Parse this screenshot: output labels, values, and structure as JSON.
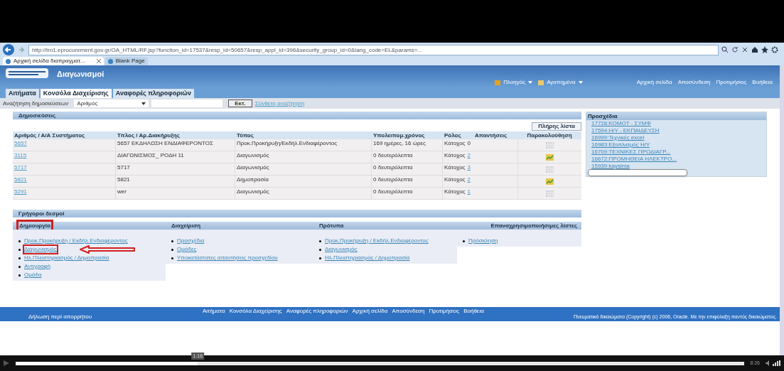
{
  "browser": {
    "address": "http://trn1.eprocurement.gov.gr/OA_HTML/RF.jsp?function_id=17537&resp_id=50657&resp_appl_id=396&security_group_id=0&lang_code=EL&params=...",
    "tabs": [
      {
        "label": "Αρχική σελίδα διαπραγματ...",
        "selected": true,
        "closable": true
      },
      {
        "label": "Blank Page",
        "selected": false,
        "closable": false
      }
    ]
  },
  "header": {
    "title": "Διαγωνισμοί",
    "menus": [
      "Πλοηγός",
      "Αγαπημένα"
    ],
    "links": [
      "Αρχική σελίδα",
      "Αποσύνδεση",
      "Προτιμήσεις",
      "Βοήθεια"
    ]
  },
  "tabs": [
    {
      "label": "Αιτήματα",
      "selected": false
    },
    {
      "label": "Κονσόλα Διαχείρισης",
      "selected": true
    },
    {
      "label": "Αναφορές πληροφοριών",
      "selected": false
    }
  ],
  "search": {
    "label": "Αναζήτηση δημοσιεύσεων",
    "select_value": "Αριθμός",
    "button": "Εκτ.",
    "advanced_link": "Σύνθετη αναζήτηση"
  },
  "publications": {
    "title": "Δημοσιεύσεις",
    "full_list_button": "Πλήρης λίστα",
    "columns": [
      "Αριθμός / Α/Α Συστήματος",
      "Τίτλος / Αρ.Διακήρυξης",
      "Τύπος",
      "Υπολειπομ.χρόνος",
      "Ρόλος",
      "Απαντήσεις",
      "Παρακολούθηση"
    ],
    "rows": [
      {
        "number": "5657",
        "title": "5657 ΕΚΔΗΛΩΣΗ ΕΝΔΙΑΦΕΡΟΝΤΟΣ",
        "type": "Προκ.Προκήρυξη/Εκδήλ.Ενδιαφέροντος",
        "time": "169 ημέρες, 16 ώρες",
        "role": "Κάτοχος",
        "responses": "0",
        "responses_link": false,
        "activity": false
      },
      {
        "number": "3115",
        "title": "ΔΙΑΓΩΝΙΣΜΟΣ_ ΡΟΔΗ 11",
        "type": "Διαγωνισμός",
        "time": "0 δευτερόλεπτα",
        "role": "Κάτοχος",
        "responses": "2",
        "responses_link": true,
        "activity": true
      },
      {
        "number": "5717",
        "title": "5717",
        "type": "Διαγωνισμός",
        "time": "0 δευτερόλεπτα",
        "role": "Κάτοχος",
        "responses": "3",
        "responses_link": true,
        "activity": false
      },
      {
        "number": "5821",
        "title": "5821",
        "type": "Δημοπρασία",
        "time": "0 δευτερόλεπτα",
        "role": "Κάτοχος",
        "responses": "2",
        "responses_link": true,
        "activity": true
      },
      {
        "number": "5291",
        "title": "wer",
        "type": "Διαγωνισμός",
        "time": "0 δευτερόλεπτα",
        "role": "Κάτοχος",
        "responses": "1",
        "responses_link": true,
        "activity": false
      }
    ]
  },
  "drafts": {
    "title": "Προσχέδια",
    "items": [
      "17728:ΚΟΜΟΤ - ΣΥΜΦ",
      "17594:Η/Υ - ΕΚΠΑΙΔΕΥΣΗ",
      "16999:Τεχνικές excel",
      "16983:Εξοπλισμός Η/Υ",
      "16709:ΤΕΧΝΙΚΕΣ ΠΡΟΔΙΑΓΡ...",
      "16672:ΠΡΟΜΗΘΕΙΑ ΗΛΕΚΤΡΟ...",
      "15939:kaysima"
    ]
  },
  "quick_links": {
    "title": "Γρήγοροι δεσμοί",
    "groups": [
      {
        "title": "Δημιουργία",
        "highlighted": true,
        "links": [
          {
            "label": "Προκ.Προκήρυξη / Εκδήλ.Ενδιαφέροντος",
            "highlighted": false
          },
          {
            "label": "Διαγωνισμός",
            "highlighted": true
          },
          {
            "label": "Ηλ.Πλειστηριασμός / Δημοπρασία",
            "highlighted": false
          },
          {
            "label": "Αντιγραφή",
            "highlighted": false
          },
          {
            "label": "Ομάδα",
            "highlighted": false
          }
        ]
      },
      {
        "title": "Διαχείριση",
        "highlighted": false,
        "links": [
          {
            "label": "Προσχέδια",
            "highlighted": false
          },
          {
            "label": "Ομάδες",
            "highlighted": false
          },
          {
            "label": "Υποκατάστατες απαντήσεις προσχεδίου",
            "highlighted": false
          }
        ]
      },
      {
        "title": "Πρότυπα",
        "highlighted": false,
        "links": [
          {
            "label": "Προκ.Προκήρυξη / Εκδήλ.Ενδιαφέροντος",
            "highlighted": false
          },
          {
            "label": "Διαγωνισμός",
            "highlighted": false
          },
          {
            "label": "Ηλ.Πλειστηριασμός / Δημοπρασία",
            "highlighted": false
          }
        ]
      },
      {
        "title": "Επαναχρησιμοποιήσιμες λίστες",
        "highlighted": false,
        "links": [
          {
            "label": "Πρόσκληση",
            "highlighted": false
          }
        ]
      }
    ]
  },
  "footer": {
    "privacy": "Δήλωση περί απορρήτου",
    "links": [
      "Αιτήματα",
      "Κονσόλα Διαχείρισης",
      "Αναφορές πληροφοριών",
      "Αρχική σελίδα",
      "Αποσύνδεση",
      "Προτιμήσεις",
      "Βοήθεια"
    ],
    "copyright": "Πνευματικά δικαιώματα (Copyright) (c) 2006, Oracle. Με την επιφύλαξη παντός δικαιώματος."
  },
  "player": {
    "position": "1:16",
    "duration": "8:26",
    "level": 0.25
  }
}
